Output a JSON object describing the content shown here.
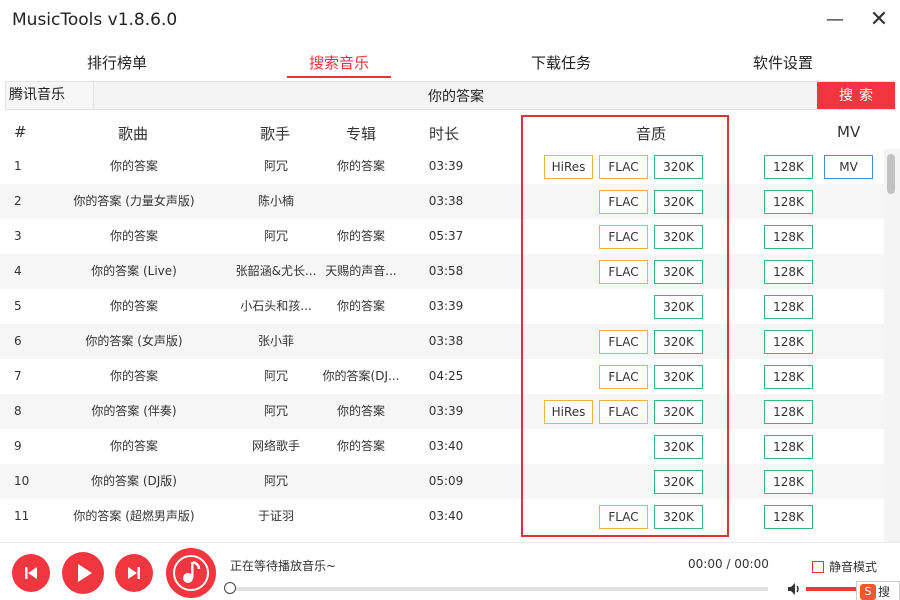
{
  "window": {
    "title": "MusicTools v1.8.6.0",
    "minimize_glyph": "—",
    "close_glyph": "✕"
  },
  "tabs": [
    {
      "label": "排行榜单",
      "active": false
    },
    {
      "label": "搜索音乐",
      "active": true
    },
    {
      "label": "下载任务",
      "active": false
    },
    {
      "label": "软件设置",
      "active": false
    }
  ],
  "search": {
    "source": "腾讯音乐",
    "query": "你的答案",
    "button_label": "搜索"
  },
  "table": {
    "headers": {
      "num": "#",
      "song": "歌曲",
      "artist": "歌手",
      "album": "专辑",
      "duration": "时长",
      "quality": "音质",
      "mv": "MV"
    },
    "quality_labels": {
      "hires": "HiRes",
      "flac": "FLAC",
      "k320": "320K",
      "k128": "128K",
      "mv": "MV"
    },
    "rows": [
      {
        "num": "1",
        "song": "你的答案",
        "artist": "阿冗",
        "album": "你的答案",
        "duration": "03:39",
        "hires": true,
        "flac": true,
        "k320": true,
        "k128": true,
        "mv": true
      },
      {
        "num": "2",
        "song": "你的答案 (力量女声版)",
        "artist": "陈小楠",
        "album": "",
        "duration": "03:38",
        "hires": false,
        "flac": true,
        "k320": true,
        "k128": true,
        "mv": false
      },
      {
        "num": "3",
        "song": "你的答案",
        "artist": "阿冗",
        "album": "你的答案",
        "duration": "05:37",
        "hires": false,
        "flac": true,
        "k320": true,
        "k128": true,
        "mv": false
      },
      {
        "num": "4",
        "song": "你的答案 (Live)",
        "artist": "张韶涵&尤长...",
        "album": "天赐的声音...",
        "duration": "03:58",
        "hires": false,
        "flac": true,
        "k320": true,
        "k128": true,
        "mv": false
      },
      {
        "num": "5",
        "song": "你的答案",
        "artist": "小石头和孩...",
        "album": "你的答案",
        "duration": "03:39",
        "hires": false,
        "flac": false,
        "k320": true,
        "k128": true,
        "mv": false
      },
      {
        "num": "6",
        "song": "你的答案 (女声版)",
        "artist": "张小菲",
        "album": "",
        "duration": "03:38",
        "hires": false,
        "flac": true,
        "k320": true,
        "k128": true,
        "mv": false
      },
      {
        "num": "7",
        "song": "你的答案",
        "artist": "阿冗",
        "album": "你的答案(DJ...",
        "duration": "04:25",
        "hires": false,
        "flac": true,
        "k320": true,
        "k128": true,
        "mv": false
      },
      {
        "num": "8",
        "song": "你的答案 (伴奏)",
        "artist": "阿冗",
        "album": "你的答案",
        "duration": "03:39",
        "hires": true,
        "flac": true,
        "k320": true,
        "k128": true,
        "mv": false
      },
      {
        "num": "9",
        "song": "你的答案",
        "artist": "网络歌手",
        "album": "你的答案",
        "duration": "03:40",
        "hires": false,
        "flac": false,
        "k320": true,
        "k128": true,
        "mv": false
      },
      {
        "num": "10",
        "song": "你的答案 (DJ版)",
        "artist": "阿冗",
        "album": "",
        "duration": "05:09",
        "hires": false,
        "flac": false,
        "k320": true,
        "k128": true,
        "mv": false
      },
      {
        "num": "11",
        "song": "你的答案 (超燃男声版)",
        "artist": "于证羽",
        "album": "",
        "duration": "03:40",
        "hires": false,
        "flac": true,
        "k320": true,
        "k128": true,
        "mv": false
      }
    ]
  },
  "player": {
    "status": "正在等待播放音乐~",
    "time": "00:00 / 00:00",
    "progress": 0,
    "mute_label": "静音模式",
    "mute_checked": false,
    "volume": 1.0
  },
  "ime": {
    "logo": "S",
    "text": "搜狗"
  },
  "colors": {
    "accent": "#f2363f",
    "flac_border": "#e7b53b",
    "green_border": "#3fb07f",
    "mv_border": "#3d8fd8"
  }
}
